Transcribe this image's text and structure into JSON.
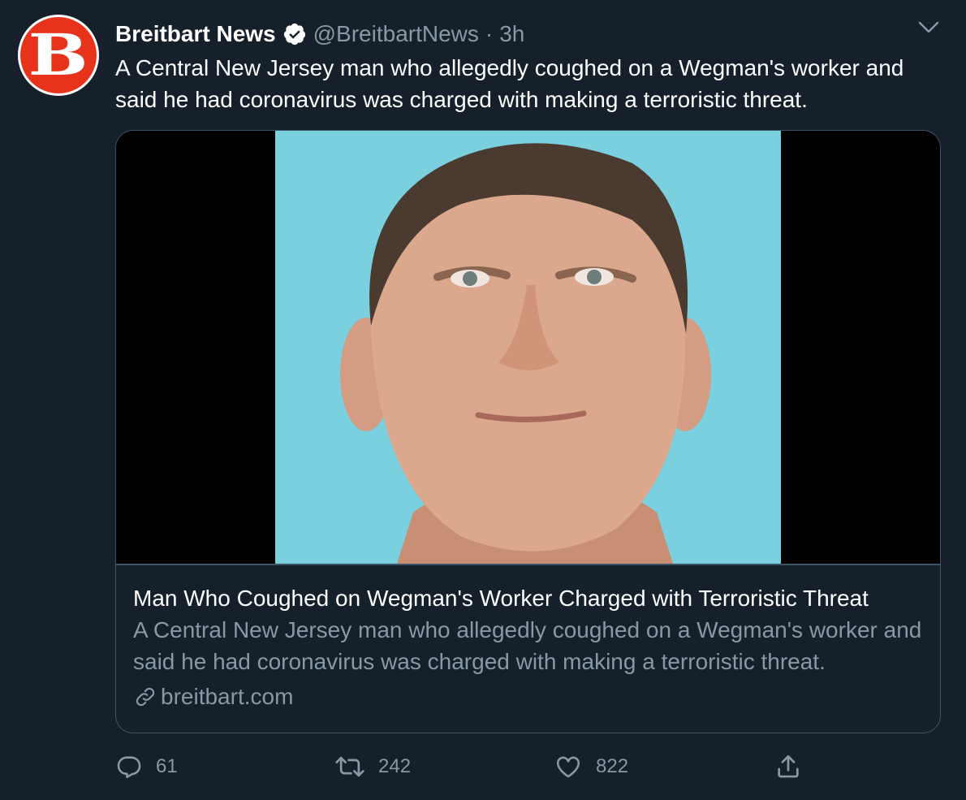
{
  "tweet": {
    "author": {
      "display_name": "Breitbart News",
      "handle": "@BreitbartNews",
      "verified": true,
      "avatar_letter": "B",
      "avatar_color": "#e8331c"
    },
    "separator": "·",
    "time": "3h",
    "text": "A Central New Jersey man who allegedly coughed on a Wegman's worker and said he had coronavirus was charged with making a terroristic threat.",
    "card": {
      "title": "Man Who Coughed on Wegman's Worker Charged with Terroristic Threat",
      "description": "A Central New Jersey man who allegedly coughed on a Wegman's worker and said he had coronavirus was charged with making a terroristic threat.",
      "domain": "breitbart.com",
      "image_background": "#7bd0df"
    },
    "actions": {
      "reply_count": "61",
      "retweet_count": "242",
      "like_count": "822"
    }
  },
  "icons": {
    "verified": "verified-badge-icon",
    "caret": "chevron-down-icon",
    "link": "link-icon",
    "reply": "reply-icon",
    "retweet": "retweet-icon",
    "like": "heart-icon",
    "share": "share-icon"
  },
  "colors": {
    "background": "#15202b",
    "secondary_text": "#8899a6",
    "border": "#3d5466"
  }
}
